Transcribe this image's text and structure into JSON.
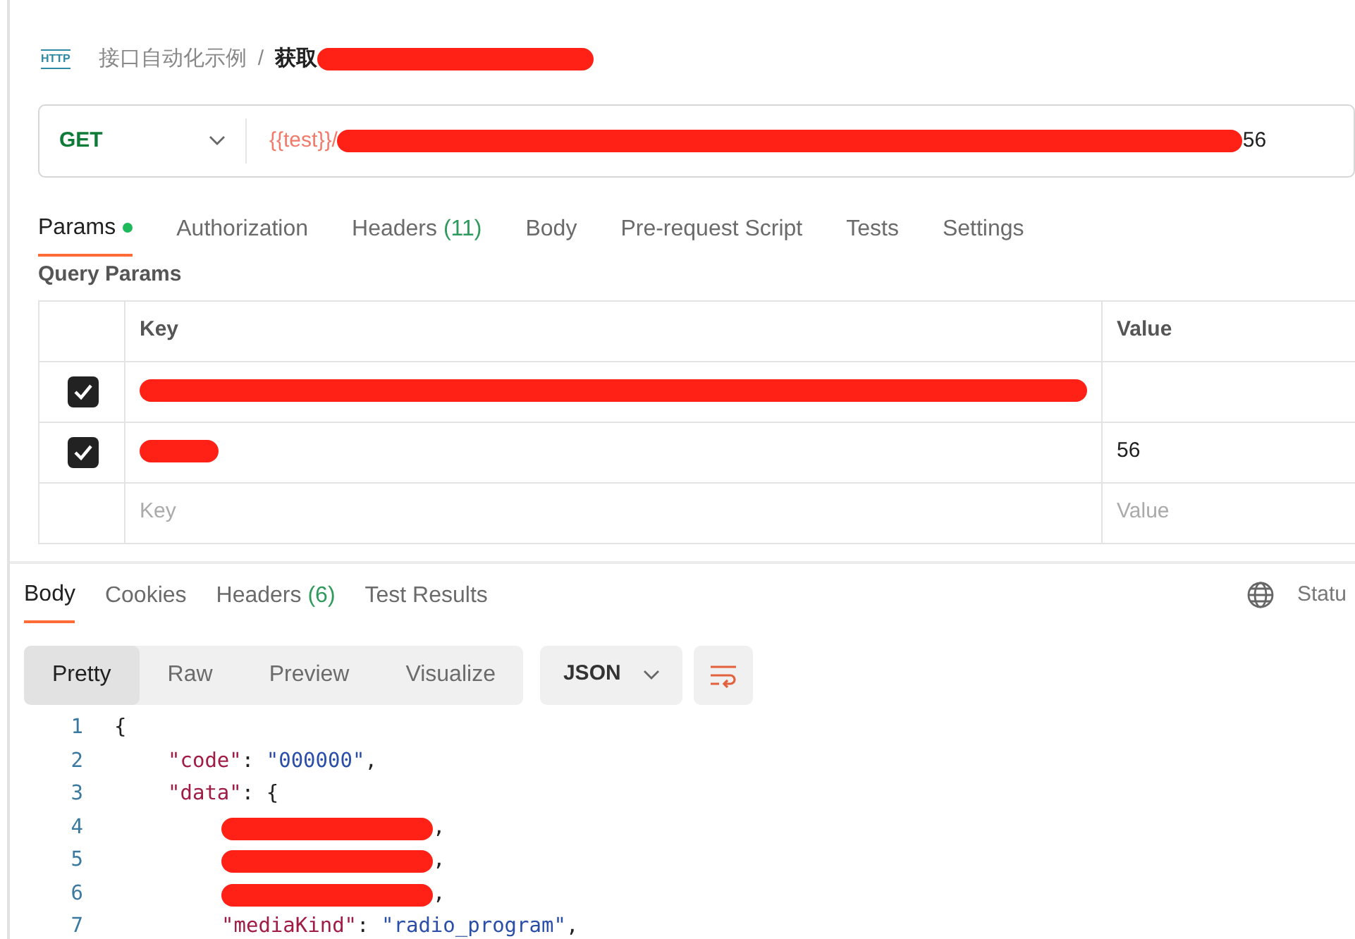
{
  "breadcrumb": {
    "icon_label": "HTTP",
    "collection": "接口自动化示例",
    "separator": "/",
    "request": "获取",
    "request_redacted": true
  },
  "request_bar": {
    "method": "GET",
    "url_prefix": "{{test}}/",
    "url_redacted": true,
    "url_suffix": "56"
  },
  "request_tabs": [
    {
      "label": "Params",
      "selected": true,
      "dot": true
    },
    {
      "label": "Authorization",
      "selected": false
    },
    {
      "label": "Headers",
      "count": "(11)",
      "selected": false
    },
    {
      "label": "Body",
      "selected": false
    },
    {
      "label": "Pre-request Script",
      "selected": false
    },
    {
      "label": "Tests",
      "selected": false
    },
    {
      "label": "Settings",
      "selected": false
    }
  ],
  "query_params": {
    "title": "Query Params",
    "columns": [
      "Key",
      "Value"
    ],
    "rows": [
      {
        "checked": true,
        "key_redacted": true,
        "kind": "long"
      },
      {
        "checked": true,
        "key_redacted": true,
        "kind": "short",
        "value": "56"
      }
    ],
    "placeholder_row": {
      "key": "Key",
      "value": "Value"
    }
  },
  "response_tabs": [
    {
      "label": "Body",
      "selected": true
    },
    {
      "label": "Cookies",
      "selected": false
    },
    {
      "label": "Headers",
      "count": "(6)",
      "selected": false
    },
    {
      "label": "Test Results",
      "selected": false
    }
  ],
  "status_label": "Statu",
  "view_modes": [
    {
      "label": "Pretty",
      "selected": true
    },
    {
      "label": "Raw",
      "selected": false
    },
    {
      "label": "Preview",
      "selected": false
    },
    {
      "label": "Visualize",
      "selected": false
    }
  ],
  "format": "JSON",
  "code": [
    {
      "num": "1",
      "tokens": [
        {
          "kind": "punct",
          "text": "{"
        }
      ],
      "children": [
        {
          "num": "2",
          "tokens": [
            {
              "kind": "key",
              "text": "\"code\""
            },
            {
              "kind": "punct",
              "text": ": "
            },
            {
              "kind": "string",
              "text": "\"000000\""
            },
            {
              "kind": "punct",
              "text": ","
            }
          ]
        },
        {
          "num": "3",
          "tokens": [
            {
              "kind": "key",
              "text": "\"data\""
            },
            {
              "kind": "punct",
              "text": ": {"
            }
          ],
          "children": [
            {
              "num": "4",
              "redacted": true,
              "tokens": [
                {
                  "kind": "punct",
                  "text": ","
                }
              ]
            },
            {
              "num": "5",
              "redacted": true,
              "tokens": [
                {
                  "kind": "punct",
                  "text": ","
                }
              ]
            },
            {
              "num": "6",
              "redacted": true,
              "tokens": [
                {
                  "kind": "punct",
                  "text": ","
                }
              ]
            },
            {
              "num": "7",
              "tokens": [
                {
                  "kind": "key",
                  "text": "\"mediaKind\""
                },
                {
                  "kind": "punct",
                  "text": ": "
                },
                {
                  "kind": "string",
                  "text": "\"radio_program\""
                },
                {
                  "kind": "punct",
                  "text": ","
                }
              ]
            }
          ]
        }
      ]
    }
  ]
}
